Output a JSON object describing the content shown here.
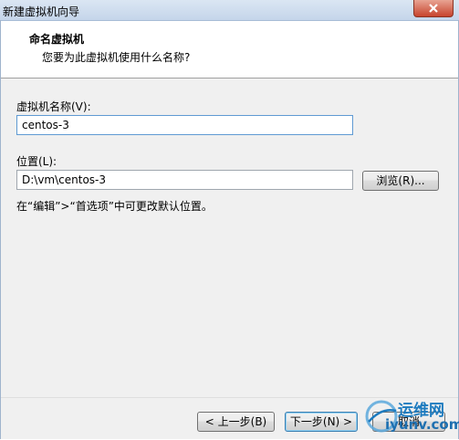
{
  "window": {
    "title": "新建虚拟机向导"
  },
  "header": {
    "title": "命名虚拟机",
    "subtitle": "您要为此虚拟机使用什么名称?"
  },
  "form": {
    "name_label": "虚拟机名称(V):",
    "name_value": "centos-3",
    "location_label": "位置(L):",
    "location_value": "D:\\vm\\centos-3",
    "browse_label": "浏览(R)...",
    "hint": "在“编辑”>“首选项”中可更改默认位置。"
  },
  "footer": {
    "back_label": "< 上一步(B)",
    "next_label": "下一步(N) >",
    "cancel_label": "取消"
  },
  "watermark": {
    "line1": "运维网",
    "line2": "iyunv.com"
  }
}
